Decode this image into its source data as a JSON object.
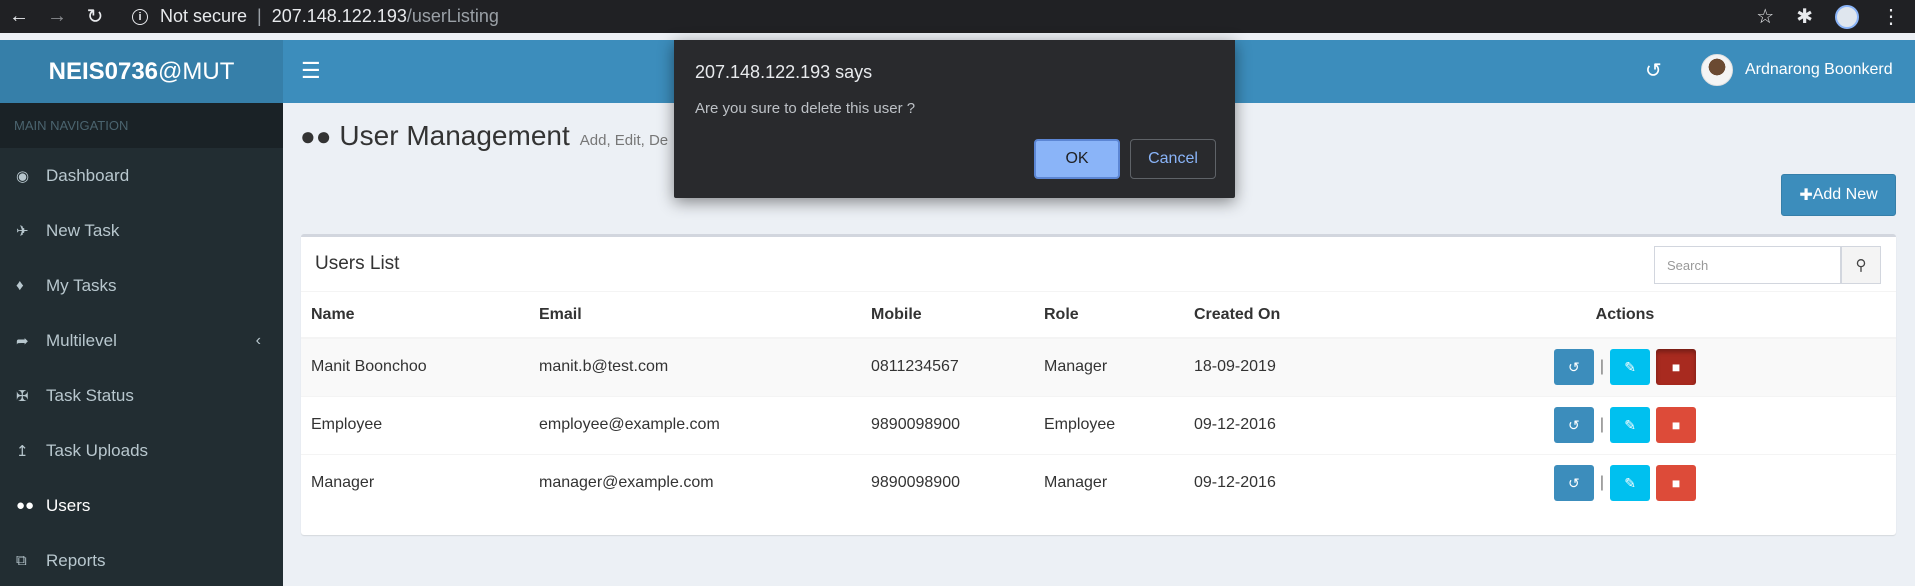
{
  "browser": {
    "not_secure": "Not secure",
    "separator": "|",
    "url_host": "207.148.122.193",
    "url_path": "/userListing"
  },
  "header": {
    "logo_bold": "NEIS0736",
    "logo_rest": "@MUT",
    "username": "Ardnarong Boonkerd"
  },
  "sidebar": {
    "nav_header": "MAIN NAVIGATION",
    "items": [
      {
        "label": "Dashboard",
        "icon": "dashboard-icon"
      },
      {
        "label": "New Task",
        "icon": "plane-icon"
      },
      {
        "label": "My Tasks",
        "icon": "ticket-icon"
      },
      {
        "label": "Multilevel",
        "icon": "share-icon"
      },
      {
        "label": "Task Status",
        "icon": "thumbtack-icon"
      },
      {
        "label": "Task Uploads",
        "icon": "upload-icon"
      },
      {
        "label": "Users",
        "icon": "users-icon"
      },
      {
        "label": "Reports",
        "icon": "files-icon"
      }
    ]
  },
  "page": {
    "title": "User Management",
    "subtitle": "Add, Edit, De",
    "add_new_label": "Add New"
  },
  "users_list": {
    "title": "Users List",
    "search_placeholder": "Search",
    "columns": [
      "Name",
      "Email",
      "Mobile",
      "Role",
      "Created On",
      "Actions"
    ],
    "rows": [
      {
        "name": "Manit Boonchoo",
        "email": "manit.b@test.com",
        "mobile": "0811234567",
        "role": "Manager",
        "created_on": "18-09-2019"
      },
      {
        "name": "Employee",
        "email": "employee@example.com",
        "mobile": "9890098900",
        "role": "Employee",
        "created_on": "09-12-2016"
      },
      {
        "name": "Manager",
        "email": "manager@example.com",
        "mobile": "9890098900",
        "role": "Manager",
        "created_on": "09-12-2016"
      }
    ],
    "action_separator": "|"
  },
  "dialog": {
    "title": "207.148.122.193 says",
    "message": "Are you sure to delete this user ?",
    "ok_label": "OK",
    "cancel_label": "Cancel"
  },
  "colors": {
    "header_blue": "#3c8dbc",
    "sidebar_dark": "#222d32",
    "delete_red": "#dd4b39",
    "edit_cyan": "#00c0ef",
    "dialog_bg": "#292a2d",
    "ok_button": "#8ab4f8"
  }
}
